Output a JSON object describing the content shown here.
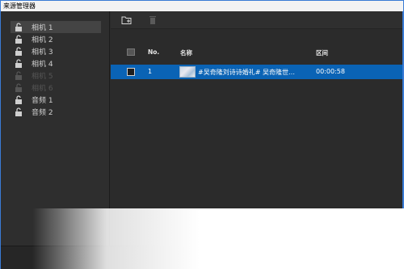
{
  "window": {
    "title": "来源管理器"
  },
  "sidebar": {
    "items": [
      {
        "label": "相机 1",
        "state": "selected"
      },
      {
        "label": "相机 2",
        "state": "normal"
      },
      {
        "label": "相机 3",
        "state": "normal"
      },
      {
        "label": "相机 4",
        "state": "normal"
      },
      {
        "label": "相机 5",
        "state": "disabled"
      },
      {
        "label": "相机 6",
        "state": "disabled"
      },
      {
        "label": "音频 1",
        "state": "normal"
      },
      {
        "label": "音频 2",
        "state": "normal"
      }
    ]
  },
  "toolbar": {
    "add_icon": "folder-add-icon",
    "delete_icon": "trash-icon"
  },
  "table": {
    "headers": {
      "no": "No.",
      "name": "名称",
      "range": "区间"
    },
    "rows": [
      {
        "no": "1",
        "name": "#吴奇隆刘诗诗婚礼# 吴奇隆世…",
        "range": "00:00:58",
        "selected": true
      }
    ]
  },
  "colors": {
    "selection": "#0a63b5",
    "background": "#2b2b2b",
    "text": "#cfcfcf"
  }
}
